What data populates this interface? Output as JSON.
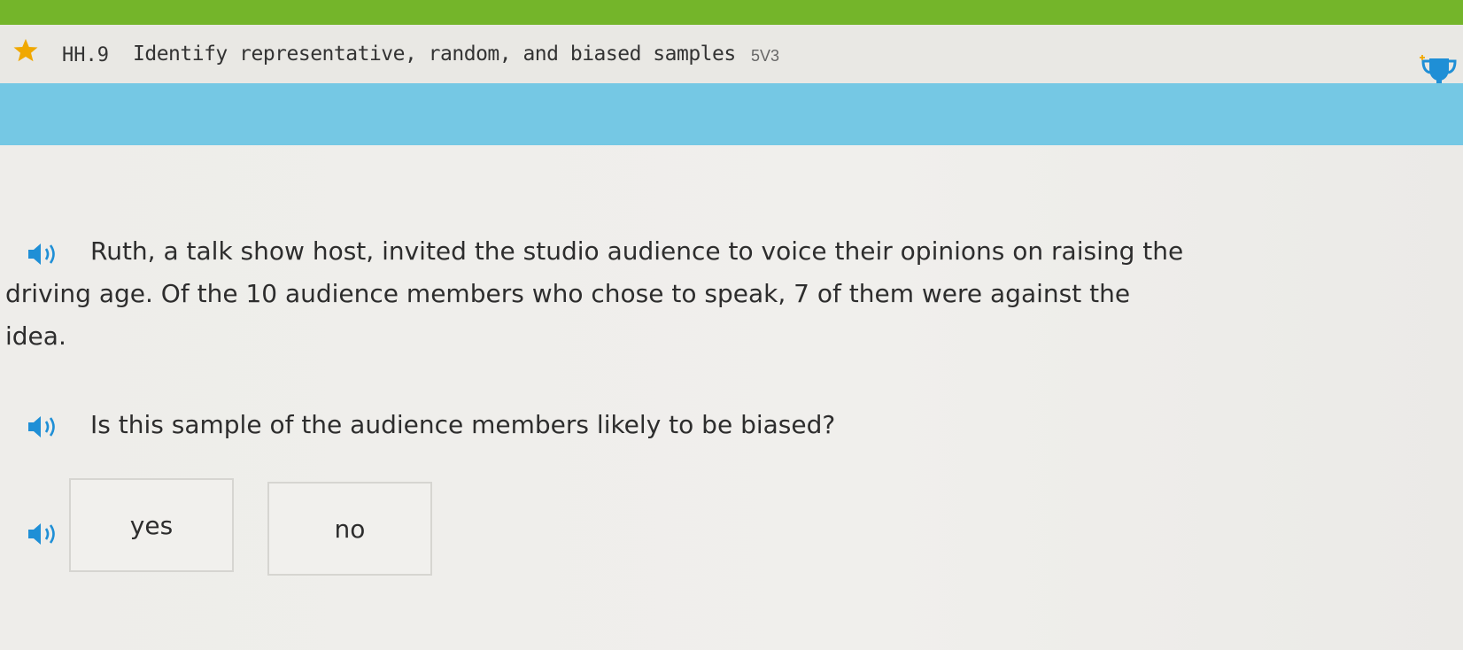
{
  "header": {
    "skill_code": "HH.9",
    "skill_title": "Identify representative, random, and biased samples",
    "skill_id": "5V3"
  },
  "question": {
    "passage_line1": "Ruth, a talk show host, invited the studio audience to voice their opinions on raising the",
    "passage_line2": "driving age. Of the 10 audience members who chose to speak, 7 of them were against the",
    "passage_line3": "idea.",
    "prompt": "Is this sample of the audience members likely to be biased?"
  },
  "choices": [
    {
      "label": "yes"
    },
    {
      "label": "no"
    }
  ],
  "icons": {
    "star": "star-icon",
    "award": "trophy-icon",
    "speaker": "speaker-icon"
  },
  "colors": {
    "top_bar": "#74b52a",
    "band": "#75c8e4",
    "star": "#f0a800",
    "speaker": "#1f8fd6"
  }
}
